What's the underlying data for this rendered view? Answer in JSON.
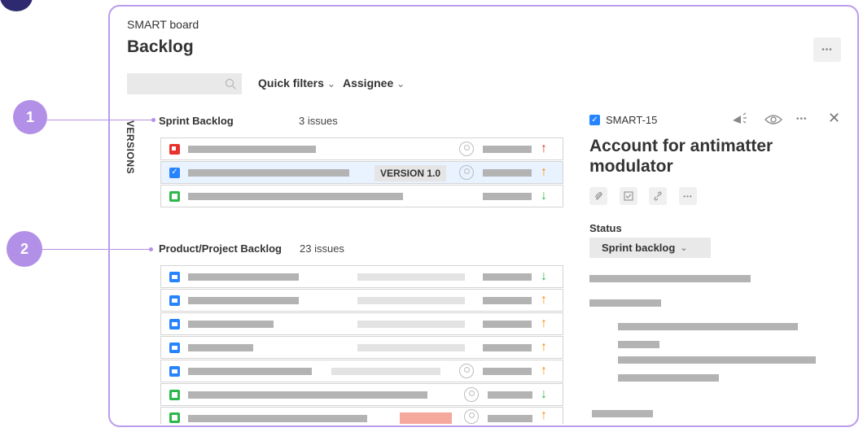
{
  "callouts": [
    "1",
    "2"
  ],
  "header": {
    "board_name": "SMART board",
    "page_title": "Backlog",
    "more_label": "•••"
  },
  "filters": {
    "search_placeholder": "",
    "quick_filters": "Quick filters",
    "assignee": "Assignee"
  },
  "side_tab": "VERSIONS",
  "sprint": {
    "title": "Sprint Backlog",
    "count": "3 issues",
    "version_tag": "VERSION 1.0"
  },
  "backlog": {
    "title": "Product/Project Backlog",
    "count": "23 issues"
  },
  "detail": {
    "issue_key": "SMART-15",
    "issue_title": "Account for antimatter modulator",
    "status_label": "Status",
    "status_value": "Sprint backlog"
  },
  "icons": {
    "arrow_up": "↑",
    "arrow_down": "↓",
    "chevron": "⌄",
    "close": "✕",
    "more": "•••"
  },
  "colors": {
    "accent_purple": "#b390e8",
    "frame_purple": "#b99cef",
    "issue_blue": "#2684ff",
    "bug_red": "#e8322b",
    "story_green": "#2db84c",
    "priority_orange": "#ff8b00"
  }
}
